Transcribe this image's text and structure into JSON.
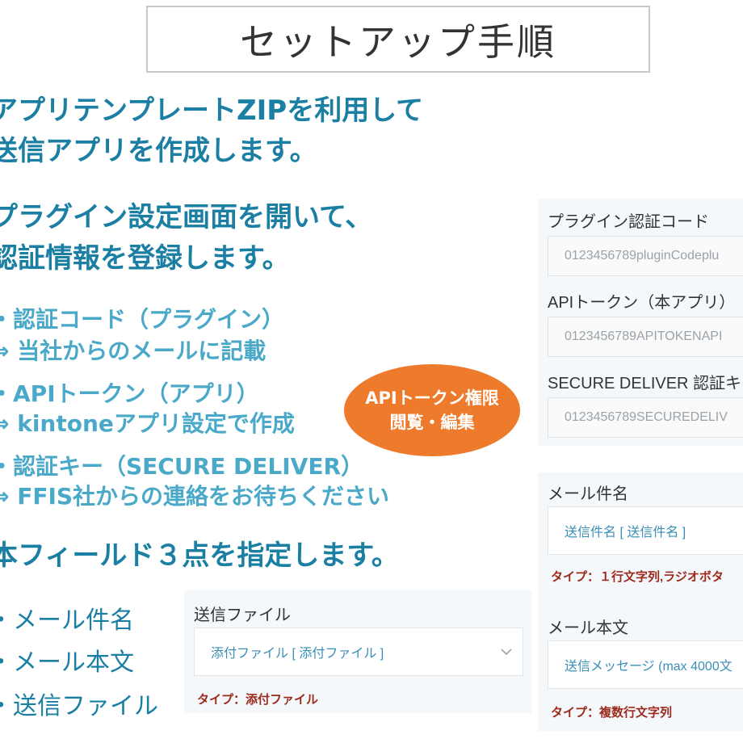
{
  "title": "セットアップ手順",
  "steps": [
    {
      "line1": "アプリテンプレートZIPを利用して",
      "line2": "送信アプリを作成します。"
    },
    {
      "line1": "プラグイン設定画面を開いて、",
      "line2": "認証情報を登録します。"
    },
    {
      "line1": "本フィールド３点を指定します。"
    }
  ],
  "auth_items": [
    {
      "label": "・認証コード（プラグイン）",
      "detail": "⇒ 当社からのメールに記載"
    },
    {
      "label": "・APIトークン（アプリ）",
      "detail": "⇒ kintoneアプリ設定で作成"
    },
    {
      "label": "・認証キー（SECURE DELIVER）",
      "detail": "⇒ FFIS社からの連絡をお待ちください"
    }
  ],
  "badge": {
    "line1": "APIトークン権限",
    "line2": "閲覧・編集"
  },
  "field_list": [
    "・メール件名",
    "・メール本文",
    "・送信ファイル"
  ],
  "auth_panel": {
    "plugin_code_label": "プラグイン認証コード",
    "plugin_code_value": "0123456789pluginCodeplu",
    "api_token_label": "APIトークン（本アプリ）",
    "api_token_value": "0123456789APITOKENAPI",
    "secure_key_label": "SECURE DELIVER 認証キ",
    "secure_key_value": "0123456789SECUREDELIV"
  },
  "mail_panel": {
    "subject_label": "メール件名",
    "subject_value": "送信件名 [ 送信件名 ]",
    "subject_type": "タイプ：１行文字列,ラジオボタ",
    "body_label": "メール本文",
    "body_value": "送信メッセージ (max 4000文",
    "body_type": "タイプ：複数行文字列"
  },
  "file_panel": {
    "label": "送信ファイル",
    "value": "添付ファイル [ 添付ファイル ]",
    "type": "タイプ：添付ファイル"
  }
}
